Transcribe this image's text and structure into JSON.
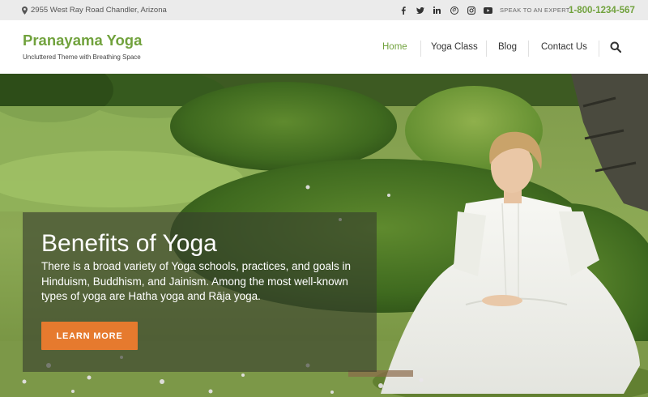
{
  "topbar": {
    "address": "2955 West Ray Road Chandler, Arizona",
    "address_icon": "map-pin-icon",
    "social_icons": [
      "facebook-icon",
      "twitter-icon",
      "linkedin-icon",
      "pinterest-icon",
      "instagram-icon",
      "youtube-icon"
    ],
    "expert_label": "SPEAK TO AN EXPERT",
    "phone": "1-800-1234-567"
  },
  "header": {
    "logo": "Pranayama Yoga",
    "tagline": "Uncluttered Theme with Breathing Space",
    "nav": [
      {
        "label": "Home",
        "active": true
      },
      {
        "label": "Yoga Class",
        "active": false
      },
      {
        "label": "Blog",
        "active": false
      },
      {
        "label": "Contact Us",
        "active": false
      }
    ],
    "search_icon": "search-icon"
  },
  "hero": {
    "title": "Benefits of Yoga",
    "text": "There is a broad variety of Yoga schools, practices, and goals in Hinduism, Buddhism, and Jainism. Among the most well-known types of yoga are Hatha yoga and Rāja yoga.",
    "button_label": "LEARN MORE"
  },
  "colors": {
    "brand_green": "#71a23d",
    "button_orange": "#e67a2e",
    "topbar_bg": "#ebebeb"
  }
}
